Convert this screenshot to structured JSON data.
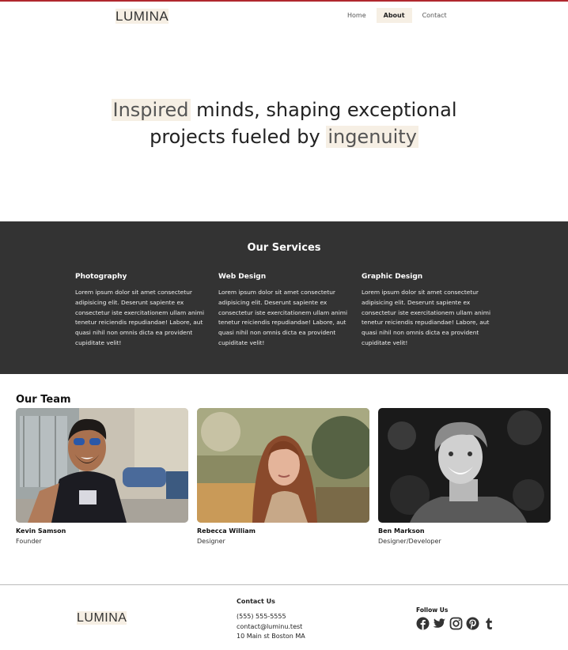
{
  "brand": {
    "logo": "LUMINA",
    "accent": "#b0282e",
    "highlight": "#f6efe4"
  },
  "nav": {
    "items": [
      "Home",
      "About",
      "Contact"
    ],
    "active": "About"
  },
  "hero": {
    "line1_word": "Inspired",
    "line1_rest": " minds, shaping exceptional",
    "line2_rest": "projects fueled by ",
    "line2_word": "ingenuity"
  },
  "services": {
    "title": "Our Services",
    "items": [
      {
        "title": "Photography",
        "text": "Lorem ipsum dolor sit amet consectetur adipisicing elit. Deserunt sapiente ex consectetur iste exercitationem ullam animi tenetur reiciendis repudiandae! Labore, aut quasi nihil non omnis dicta ea provident cupiditate velit!"
      },
      {
        "title": "Web Design",
        "text": "Lorem ipsum dolor sit amet consectetur adipisicing elit. Deserunt sapiente ex consectetur iste exercitationem ullam animi tenetur reiciendis repudiandae! Labore, aut quasi nihil non omnis dicta ea provident cupiditate velit!"
      },
      {
        "title": "Graphic Design",
        "text": "Lorem ipsum dolor sit amet consectetur adipisicing elit. Deserunt sapiente ex consectetur iste exercitationem ullam animi tenetur reiciendis repudiandae! Labore, aut quasi nihil non omnis dicta ea provident cupiditate velit!"
      }
    ]
  },
  "team": {
    "title": "Our Team",
    "members": [
      {
        "name": "Kevin Samson",
        "role": "Founder"
      },
      {
        "name": "Rebecca William",
        "role": "Designer"
      },
      {
        "name": "Ben Markson",
        "role": "Designer/Developer"
      }
    ]
  },
  "footer": {
    "logo": "LUMINA",
    "contact": {
      "title": "Contact Us",
      "phone": "(555) 555-5555",
      "email": "contact@luminu.test",
      "address": "10 Main st Boston MA"
    },
    "follow": {
      "title": "Follow Us",
      "icons": [
        "facebook-icon",
        "twitter-icon",
        "instagram-icon",
        "pinterest-icon",
        "tumblr-icon"
      ]
    }
  }
}
